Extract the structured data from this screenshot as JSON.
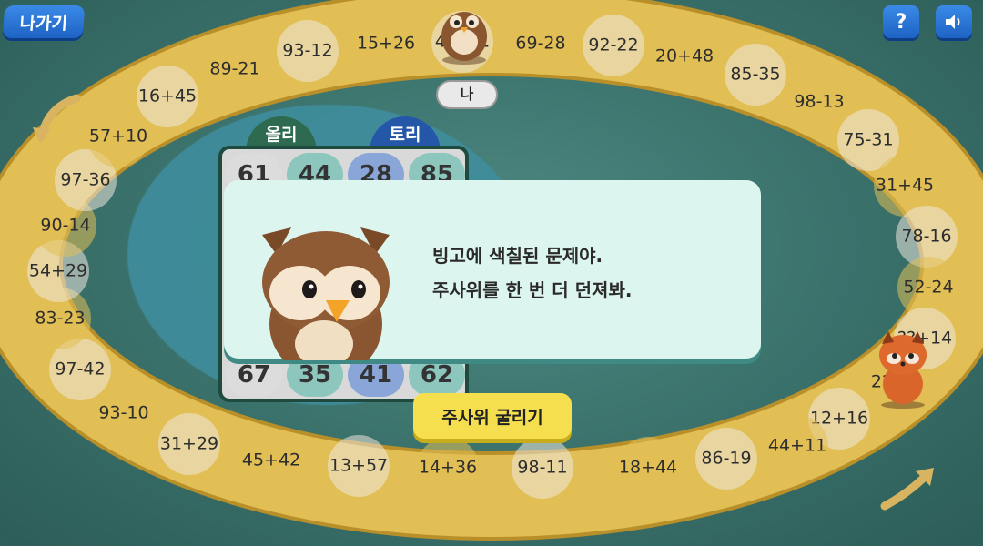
{
  "top": {
    "exit_label": "나가기",
    "help_label": "?",
    "sound_icon": "speaker-icon"
  },
  "board": {
    "cells": [
      "89-21",
      "93-12",
      "15+26",
      "4?+?1",
      "69-28",
      "92-22",
      "20+48",
      "85-35",
      "98-13",
      "75-31",
      "31+45",
      "78-16",
      "52-24",
      "??+14",
      "2?",
      "12+16",
      "44+11",
      "86-19",
      "18+44",
      "98-11",
      "14+36",
      "13+57",
      "45+42",
      "31+29",
      "93-10",
      "97-42",
      "83-23",
      "54+29",
      "90-14",
      "97-36",
      "57+10",
      "16+45"
    ]
  },
  "players": {
    "olli": "올리",
    "tori": "토리"
  },
  "bingo": {
    "top_row": [
      "61",
      "44",
      "28",
      "85"
    ],
    "bottom_row": [
      "67",
      "35",
      "41",
      "62"
    ]
  },
  "current_player_tag": "나",
  "dialog": {
    "line1": "빙고에 색칠된 문제야.",
    "line2": "주사위를 한 번 더 던져봐."
  },
  "roll_button": "주사위 굴리기",
  "colors": {
    "track_gold": "#e2bf55",
    "track_white": "#ece8dc",
    "button_yellow": "#f6df4f",
    "blue_button": "#2a74d6"
  }
}
